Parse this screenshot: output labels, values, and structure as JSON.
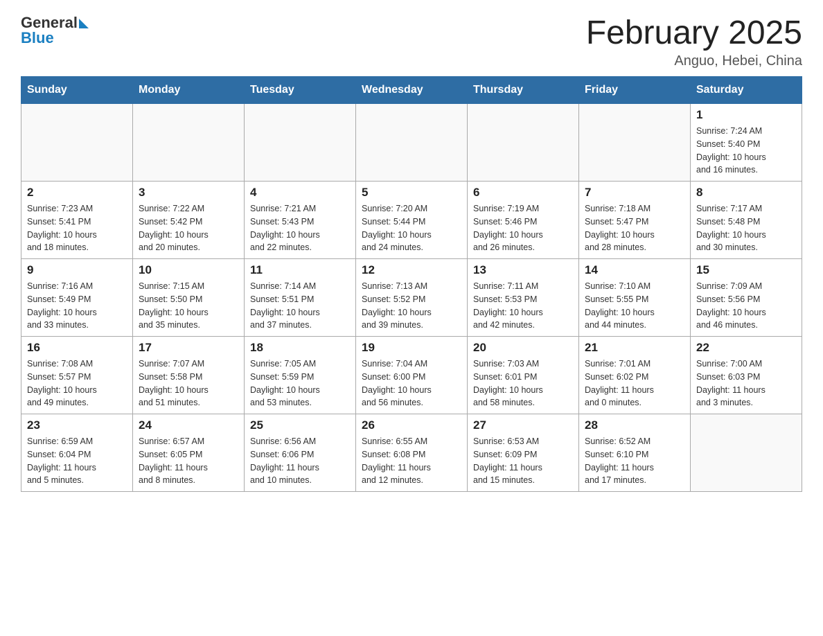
{
  "header": {
    "logo_general": "General",
    "logo_blue": "Blue",
    "title": "February 2025",
    "subtitle": "Anguo, Hebei, China"
  },
  "days_of_week": [
    "Sunday",
    "Monday",
    "Tuesday",
    "Wednesday",
    "Thursday",
    "Friday",
    "Saturday"
  ],
  "weeks": [
    [
      {
        "day": "",
        "info": ""
      },
      {
        "day": "",
        "info": ""
      },
      {
        "day": "",
        "info": ""
      },
      {
        "day": "",
        "info": ""
      },
      {
        "day": "",
        "info": ""
      },
      {
        "day": "",
        "info": ""
      },
      {
        "day": "1",
        "info": "Sunrise: 7:24 AM\nSunset: 5:40 PM\nDaylight: 10 hours\nand 16 minutes."
      }
    ],
    [
      {
        "day": "2",
        "info": "Sunrise: 7:23 AM\nSunset: 5:41 PM\nDaylight: 10 hours\nand 18 minutes."
      },
      {
        "day": "3",
        "info": "Sunrise: 7:22 AM\nSunset: 5:42 PM\nDaylight: 10 hours\nand 20 minutes."
      },
      {
        "day": "4",
        "info": "Sunrise: 7:21 AM\nSunset: 5:43 PM\nDaylight: 10 hours\nand 22 minutes."
      },
      {
        "day": "5",
        "info": "Sunrise: 7:20 AM\nSunset: 5:44 PM\nDaylight: 10 hours\nand 24 minutes."
      },
      {
        "day": "6",
        "info": "Sunrise: 7:19 AM\nSunset: 5:46 PM\nDaylight: 10 hours\nand 26 minutes."
      },
      {
        "day": "7",
        "info": "Sunrise: 7:18 AM\nSunset: 5:47 PM\nDaylight: 10 hours\nand 28 minutes."
      },
      {
        "day": "8",
        "info": "Sunrise: 7:17 AM\nSunset: 5:48 PM\nDaylight: 10 hours\nand 30 minutes."
      }
    ],
    [
      {
        "day": "9",
        "info": "Sunrise: 7:16 AM\nSunset: 5:49 PM\nDaylight: 10 hours\nand 33 minutes."
      },
      {
        "day": "10",
        "info": "Sunrise: 7:15 AM\nSunset: 5:50 PM\nDaylight: 10 hours\nand 35 minutes."
      },
      {
        "day": "11",
        "info": "Sunrise: 7:14 AM\nSunset: 5:51 PM\nDaylight: 10 hours\nand 37 minutes."
      },
      {
        "day": "12",
        "info": "Sunrise: 7:13 AM\nSunset: 5:52 PM\nDaylight: 10 hours\nand 39 minutes."
      },
      {
        "day": "13",
        "info": "Sunrise: 7:11 AM\nSunset: 5:53 PM\nDaylight: 10 hours\nand 42 minutes."
      },
      {
        "day": "14",
        "info": "Sunrise: 7:10 AM\nSunset: 5:55 PM\nDaylight: 10 hours\nand 44 minutes."
      },
      {
        "day": "15",
        "info": "Sunrise: 7:09 AM\nSunset: 5:56 PM\nDaylight: 10 hours\nand 46 minutes."
      }
    ],
    [
      {
        "day": "16",
        "info": "Sunrise: 7:08 AM\nSunset: 5:57 PM\nDaylight: 10 hours\nand 49 minutes."
      },
      {
        "day": "17",
        "info": "Sunrise: 7:07 AM\nSunset: 5:58 PM\nDaylight: 10 hours\nand 51 minutes."
      },
      {
        "day": "18",
        "info": "Sunrise: 7:05 AM\nSunset: 5:59 PM\nDaylight: 10 hours\nand 53 minutes."
      },
      {
        "day": "19",
        "info": "Sunrise: 7:04 AM\nSunset: 6:00 PM\nDaylight: 10 hours\nand 56 minutes."
      },
      {
        "day": "20",
        "info": "Sunrise: 7:03 AM\nSunset: 6:01 PM\nDaylight: 10 hours\nand 58 minutes."
      },
      {
        "day": "21",
        "info": "Sunrise: 7:01 AM\nSunset: 6:02 PM\nDaylight: 11 hours\nand 0 minutes."
      },
      {
        "day": "22",
        "info": "Sunrise: 7:00 AM\nSunset: 6:03 PM\nDaylight: 11 hours\nand 3 minutes."
      }
    ],
    [
      {
        "day": "23",
        "info": "Sunrise: 6:59 AM\nSunset: 6:04 PM\nDaylight: 11 hours\nand 5 minutes."
      },
      {
        "day": "24",
        "info": "Sunrise: 6:57 AM\nSunset: 6:05 PM\nDaylight: 11 hours\nand 8 minutes."
      },
      {
        "day": "25",
        "info": "Sunrise: 6:56 AM\nSunset: 6:06 PM\nDaylight: 11 hours\nand 10 minutes."
      },
      {
        "day": "26",
        "info": "Sunrise: 6:55 AM\nSunset: 6:08 PM\nDaylight: 11 hours\nand 12 minutes."
      },
      {
        "day": "27",
        "info": "Sunrise: 6:53 AM\nSunset: 6:09 PM\nDaylight: 11 hours\nand 15 minutes."
      },
      {
        "day": "28",
        "info": "Sunrise: 6:52 AM\nSunset: 6:10 PM\nDaylight: 11 hours\nand 17 minutes."
      },
      {
        "day": "",
        "info": ""
      }
    ]
  ]
}
